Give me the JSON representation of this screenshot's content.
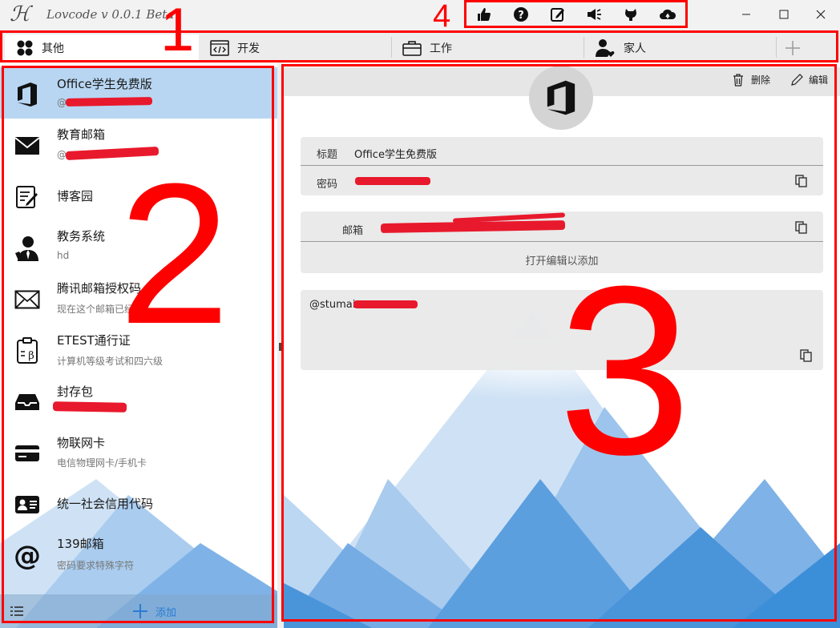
{
  "app": {
    "logo_glyph": "ℋ",
    "title": "Lovcode  v 0.0.1 Beta"
  },
  "toolbar": {
    "icons": [
      "thumbs-up-icon",
      "help-icon",
      "edit-note-icon",
      "announce-icon",
      "github-icon",
      "cloud-sync-icon"
    ]
  },
  "window_controls": [
    "minimize",
    "maximize",
    "close"
  ],
  "tabs": [
    {
      "label": "其他",
      "icon": "grid-icon",
      "active": true
    },
    {
      "label": "开发",
      "icon": "code-icon",
      "active": false
    },
    {
      "label": "工作",
      "icon": "briefcase-icon",
      "active": false
    },
    {
      "label": "家人",
      "icon": "family-icon",
      "active": false
    }
  ],
  "list": [
    {
      "title": "Office学生免费版",
      "subtitle": "@",
      "icon": "office-icon",
      "selected": true
    },
    {
      "title": "教育邮箱",
      "subtitle": "@",
      "icon": "mail-icon"
    },
    {
      "title": "博客园",
      "subtitle": "",
      "icon": "blog-icon"
    },
    {
      "title": "教务系统",
      "subtitle": "hd",
      "icon": "user-tie-icon"
    },
    {
      "title": "腾讯邮箱授权码",
      "subtitle": "现在这个邮箱已经",
      "icon": "mail-outline-icon"
    },
    {
      "title": "ETEST通行证",
      "subtitle": "计算机等级考试和四六级",
      "icon": "clipboard-beta-icon"
    },
    {
      "title": "封存包",
      "subtitle": "",
      "icon": "inbox-icon"
    },
    {
      "title": "物联网卡",
      "subtitle": "电信物理网卡/手机卡",
      "icon": "card-icon"
    },
    {
      "title": "统一社会信用代码",
      "subtitle": "",
      "icon": "id-card-icon"
    },
    {
      "title": "139邮箱",
      "subtitle": "密码要求特殊字符",
      "icon": "at-icon"
    }
  ],
  "footer": {
    "add_label": "添加"
  },
  "detail": {
    "delete_label": "删除",
    "edit_label": "编辑",
    "title_label": "标题",
    "title_value": "Office学生免费版",
    "password_label": "密码",
    "email_label": "邮箱",
    "add_hint": "打开编辑以添加",
    "note": "@stumai"
  },
  "annotations": [
    "1",
    "2",
    "3",
    "4"
  ],
  "colors": {
    "selected": "#b8d6f2",
    "annotation": "#ff0000",
    "redaction": "#e8192c",
    "accent": "#3b8fd9"
  }
}
